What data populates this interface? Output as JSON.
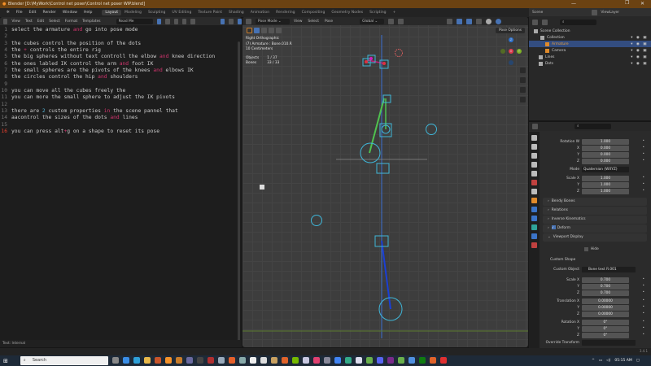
{
  "title": "Blender [D:\\MyWork\\Control net poser\\Control net poser WIP.blend]",
  "window_controls": {
    "minimize": "—",
    "maximize": "❐",
    "close": "✕"
  },
  "menu": [
    "File",
    "Edit",
    "Render",
    "Window",
    "Help"
  ],
  "workspaces": [
    "Layout",
    "Modeling",
    "Sculpting",
    "UV Editing",
    "Texture Paint",
    "Shading",
    "Animation",
    "Rendering",
    "Compositing",
    "Geometry Nodes",
    "Scripting",
    "+"
  ],
  "active_workspace": "Layout",
  "text_editor": {
    "menu": [
      "View",
      "Text",
      "Edit",
      "Select",
      "Format",
      "Templates"
    ],
    "file_name": "Read Me",
    "status": "Text: Internal",
    "current_line": 16,
    "lines": [
      [
        [
          "select the armature ",
          ""
        ],
        [
          "and",
          "kw"
        ],
        [
          " go into pose mode",
          ""
        ]
      ],
      [],
      [
        [
          "the cubes control the position of the dots",
          ""
        ]
      ],
      [
        [
          "the ",
          ""
        ],
        [
          "+",
          "kw"
        ],
        [
          " controls the entire rig",
          ""
        ]
      ],
      [
        [
          "the big spheres without text controll the elbow ",
          ""
        ],
        [
          "and",
          "kw"
        ],
        [
          " knee direction",
          ""
        ]
      ],
      [
        [
          "the ones labled IK control the arm ",
          ""
        ],
        [
          "and",
          "kw"
        ],
        [
          " foot IK",
          ""
        ]
      ],
      [
        [
          "the small spheres are the pivots of the knees ",
          ""
        ],
        [
          "and",
          "kw"
        ],
        [
          " elbows IK",
          ""
        ]
      ],
      [
        [
          "the circles control the hip ",
          ""
        ],
        [
          "and",
          "kw"
        ],
        [
          " shoulders",
          ""
        ]
      ],
      [],
      [
        [
          "you can move all the cubes freely the",
          ""
        ]
      ],
      [
        [
          "you can more the small sphere to adjust the IK pivots",
          ""
        ]
      ],
      [],
      [
        [
          "there are ",
          ""
        ],
        [
          "2",
          "num2"
        ],
        [
          " custom properties ",
          ""
        ],
        [
          "in",
          "kw"
        ],
        [
          " the scene pannel that",
          ""
        ]
      ],
      [
        [
          "aacontrol the sizes of the dots ",
          ""
        ],
        [
          "and",
          "kw"
        ],
        [
          " lines",
          ""
        ]
      ],
      [],
      [
        [
          "you can press alt",
          ""
        ],
        [
          "+",
          "kw"
        ],
        [
          "g on a shape to reset its pose",
          ""
        ]
      ]
    ]
  },
  "viewport": {
    "mode": "Pose Mode",
    "menu": [
      "View",
      "Select",
      "Pose"
    ],
    "orientation": "Global",
    "pose_options": "Pose Options",
    "overlay": {
      "view": "Right Orthographic",
      "context": "(7) Armature : Bone.010.R",
      "scale": "10 Centimeters",
      "objects_label": "Objects",
      "objects_value": "1 / 37",
      "bones_label": "Bones",
      "bones_value": "33 / 33"
    },
    "gizmo_axes": {
      "z": "Z",
      "x": "X",
      "y": "Y"
    },
    "colors": {
      "bone_blue": "#1a3fd6",
      "bone_green": "#4fc24f",
      "control_cyan": "#3fb6d8",
      "selected_pink": "#e0209a"
    }
  },
  "outliner": {
    "scene": "Scene",
    "view_layer": "ViewLayer",
    "items": [
      {
        "label": "Scene Collection",
        "selected": false
      },
      {
        "label": "Collection",
        "selected": false
      },
      {
        "label": "Armature",
        "selected": true
      },
      {
        "label": "Camera",
        "selected": false
      },
      {
        "label": "Lines",
        "selected": false
      },
      {
        "label": "Dots",
        "selected": false
      }
    ]
  },
  "properties": {
    "rotation": [
      {
        "label": "Rotation W",
        "value": "1.000"
      },
      {
        "label": "X",
        "value": "0.000"
      },
      {
        "label": "Y",
        "value": "0.000"
      },
      {
        "label": "Z",
        "value": "0.000"
      }
    ],
    "mode_label": "Mode",
    "mode_value": "Quaternion (WXYZ)",
    "scale": [
      {
        "label": "Scale X",
        "value": "1.000"
      },
      {
        "label": "Y",
        "value": "1.000"
      },
      {
        "label": "Z",
        "value": "1.000"
      }
    ],
    "panels": [
      "Bendy Bones",
      "Relations",
      "Inverse Kinematics",
      "Deform",
      "Viewport Display"
    ],
    "deform_checked": true,
    "hide_label": "Hide",
    "custom_shape_label": "Custom Shape",
    "custom_object_label": "Custom Object",
    "custom_object_value": "Bone text R.001",
    "shape_scale": [
      {
        "label": "Scale X",
        "value": "0.700"
      },
      {
        "label": "Y",
        "value": "0.700"
      },
      {
        "label": "Z",
        "value": "0.700"
      }
    ],
    "translation": [
      {
        "label": "Translation X",
        "value": "0.00000"
      },
      {
        "label": "Y",
        "value": "0.00000"
      },
      {
        "label": "Z",
        "value": "0.00000"
      }
    ],
    "shape_rotation": [
      {
        "label": "Rotation X",
        "value": "0°"
      },
      {
        "label": "Y",
        "value": "0°"
      },
      {
        "label": "Z",
        "value": "0°"
      }
    ],
    "override_label": "Override Transform"
  },
  "statusbar": {
    "version": "3.4.1"
  },
  "taskbar": {
    "search_placeholder": "Search",
    "time": "05:15 AM"
  }
}
